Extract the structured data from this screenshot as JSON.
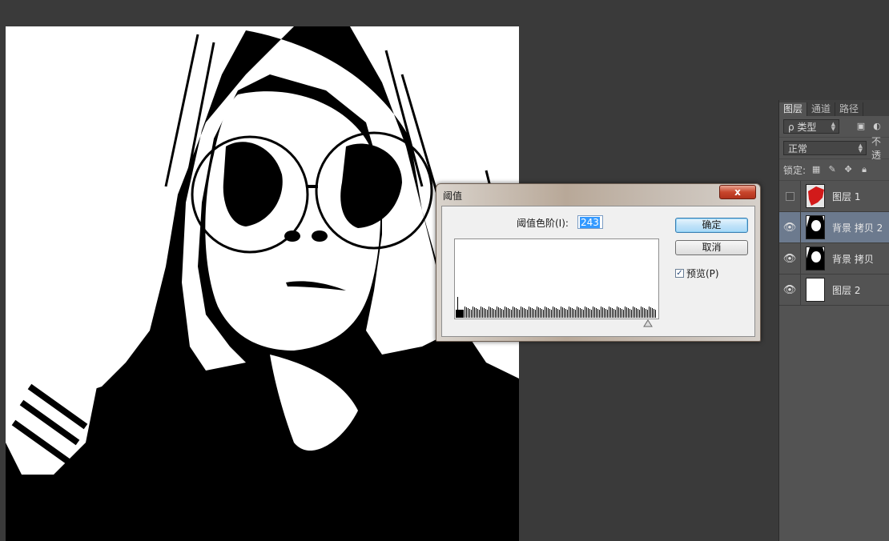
{
  "threshold_dialog": {
    "title": "阈值",
    "close_glyph": "x",
    "level_label": "阈值色阶(I):",
    "level_value": "243",
    "ok_label": "确定",
    "cancel_label": "取消",
    "preview_label": "预览(P)",
    "preview_checked": true
  },
  "layers_panel": {
    "tabs": [
      {
        "label": "图层",
        "active": true
      },
      {
        "label": "通道",
        "active": false
      },
      {
        "label": "路径",
        "active": false
      }
    ],
    "filter_label": "ρ 类型",
    "blend_mode": "正常",
    "opacity_label": "不透",
    "lock_label": "锁定:",
    "layers": [
      {
        "name": "图层 1",
        "visible": false,
        "selected": false,
        "thumb": "red-splash"
      },
      {
        "name": "背景 拷贝 2",
        "visible": true,
        "selected": true,
        "thumb": "threshold"
      },
      {
        "name": "背景 拷贝",
        "visible": true,
        "selected": false,
        "thumb": "threshold"
      },
      {
        "name": "图层 2",
        "visible": true,
        "selected": false,
        "thumb": "white"
      }
    ]
  }
}
